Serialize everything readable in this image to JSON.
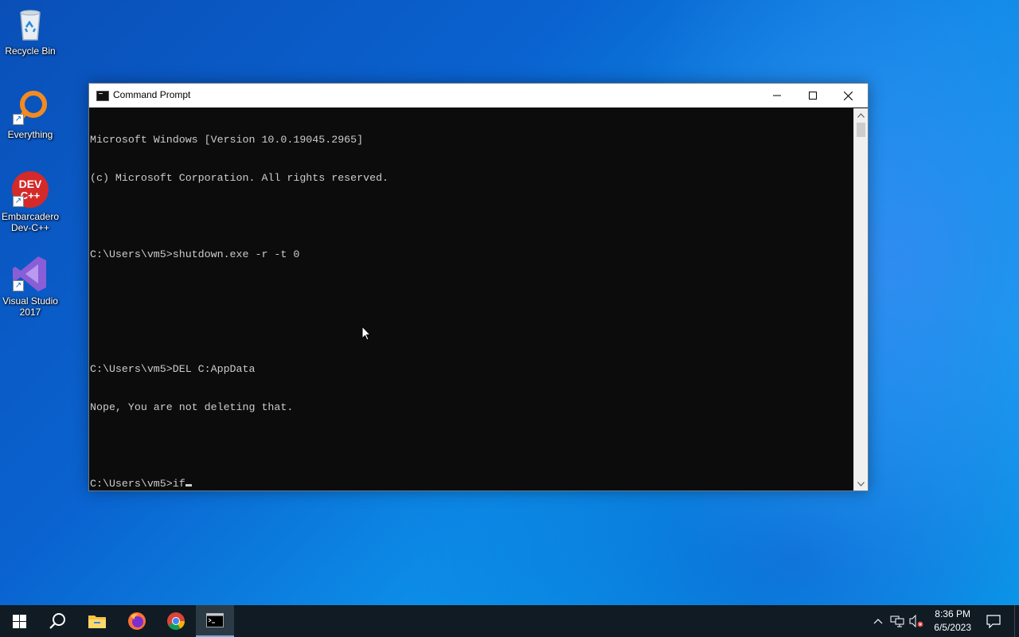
{
  "desktop": {
    "icons": [
      {
        "label": "Recycle Bin"
      },
      {
        "label": "Everything"
      },
      {
        "label": "Embarcadero Dev-C++"
      },
      {
        "label": "Visual Studio 2017"
      }
    ]
  },
  "window": {
    "title": "Command Prompt",
    "console_lines": [
      "Microsoft Windows [Version 10.0.19045.2965]",
      "(c) Microsoft Corporation. All rights reserved.",
      "",
      "C:\\Users\\vm5>shutdown.exe -r -t 0",
      "",
      "",
      "C:\\Users\\vm5>DEL C:AppData",
      "Nope, You are not deleting that.",
      "",
      "C:\\Users\\vm5>if"
    ]
  },
  "taskbar": {
    "time": "8:36 PM",
    "date": "6/5/2023",
    "apps": [
      "start-icon",
      "search-icon",
      "file-explorer-icon",
      "firefox-icon",
      "chrome-icon",
      "command-prompt-icon"
    ]
  },
  "colors": {
    "console_bg": "#0c0c0c",
    "console_text": "#cccccc",
    "taskbar_bg": "#101b24"
  }
}
